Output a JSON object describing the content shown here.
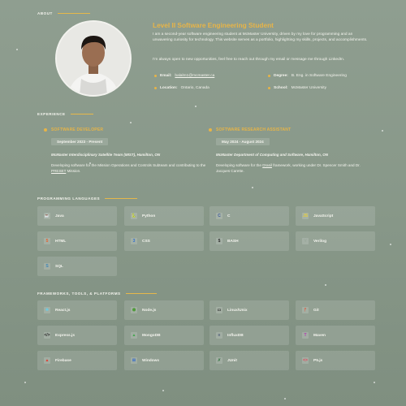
{
  "about": {
    "heading": "ABOUT",
    "title": "Level II Software Engineering Student",
    "paragraph1": "I am a second-year software engineering student at McMaster University, driven by my love for programming and an unwavering curiosity for technology. This website serves as a portfolio, highlighting my skills, projects, and accomplishments.",
    "paragraph2": "I'm always open to new opportunities, feel free to reach out through my email or message me through LinkedIn.",
    "email_label": "Email:",
    "email_value": "balalm1@mcmaster.ca",
    "degree_label": "Degree:",
    "degree_value": "B. Eng. in Software Engineering",
    "location_label": "Location:",
    "location_value": "Ontario, Canada",
    "school_label": "School:",
    "school_value": "McMaster University"
  },
  "experience": {
    "heading": "EXPERIENCE",
    "items": [
      {
        "role": "SOFTWARE DEVELOPER",
        "date": "September 2023 - Present",
        "org": "McMaster Interdisciplinary Satellite Team (MIST), Hamilton, ON",
        "desc_a": "Developing software for the Mission Operations and Controls Subteam and contributing to the ",
        "desc_link": "PRESET",
        "desc_b": " Mission."
      },
      {
        "role": "SOFTWARE RESEARCH ASSISTANT",
        "date": "May 2024 - August 2024",
        "org": "McMaster Department of Computing and Software, Hamilton, ON",
        "desc_a": "Developing software for the ",
        "desc_link": "Drasil",
        "desc_b": " framework, working under Dr. Spencer Smith and Dr. Jacques Carette."
      }
    ]
  },
  "languages": {
    "heading": "PROGRAMMING LANGUAGES",
    "items": [
      {
        "label": "Java",
        "icon": "java-icon",
        "color": "#e8843a",
        "glyph": "☕"
      },
      {
        "label": "Python",
        "icon": "python-icon",
        "color": "#4a7fb5",
        "glyph": "🐍"
      },
      {
        "label": "C",
        "icon": "c-icon",
        "color": "#3d5a9e",
        "glyph": "C"
      },
      {
        "label": "JavaScript",
        "icon": "javascript-icon",
        "color": "#e6cf3a",
        "glyph": "JS"
      },
      {
        "label": "HTML",
        "icon": "html-icon",
        "color": "#e8602c",
        "glyph": "5"
      },
      {
        "label": "CSS",
        "icon": "css-icon",
        "color": "#2f6fd0",
        "glyph": "3"
      },
      {
        "label": "BASH",
        "icon": "bash-icon",
        "color": "#333333",
        "glyph": "$"
      },
      {
        "label": "Verilog",
        "icon": "verilog-icon",
        "color": "#9aa89b",
        "glyph": "V"
      },
      {
        "label": "SQL",
        "icon": "sql-icon",
        "color": "#3e86b8",
        "glyph": "S"
      }
    ]
  },
  "frameworks": {
    "heading": "FRAMEWORKS, TOOLS, & PLATFORMS",
    "items": [
      {
        "label": "React.js",
        "icon": "react-icon",
        "color": "#5ed3f3",
        "glyph": "⚛"
      },
      {
        "label": "Node.js",
        "icon": "nodejs-icon",
        "color": "#4f9b3a",
        "glyph": "⬢"
      },
      {
        "label": "Linux/Unix",
        "icon": "linux-icon",
        "color": "#2f2f2f",
        "glyph": "▭"
      },
      {
        "label": "Git",
        "icon": "git-icon",
        "color": "#e84d31",
        "glyph": "ᚠ"
      },
      {
        "label": "Express.js",
        "icon": "express-icon",
        "color": "#2a2a2a",
        "glyph": "</>"
      },
      {
        "label": "MongoDB",
        "icon": "mongodb-icon",
        "color": "#3fa64a",
        "glyph": "▲"
      },
      {
        "label": "InfluxDB",
        "icon": "influxdb-icon",
        "color": "#2b3a66",
        "glyph": "≡"
      },
      {
        "label": "Maven",
        "icon": "maven-icon",
        "color": "#b23ab0",
        "glyph": "T"
      },
      {
        "label": "Firebase",
        "icon": "firebase-icon",
        "color": "#e23a2f",
        "glyph": "▲"
      },
      {
        "label": "Windows",
        "icon": "windows-icon",
        "color": "#3a6fc9",
        "glyph": "⊞"
      },
      {
        "label": "JUnit",
        "icon": "junit-icon",
        "color": "#3d7a4a",
        "glyph": "✗"
      },
      {
        "label": "P5.js",
        "icon": "p5js-icon",
        "color": "#e8435a",
        "glyph": "<>"
      }
    ]
  }
}
